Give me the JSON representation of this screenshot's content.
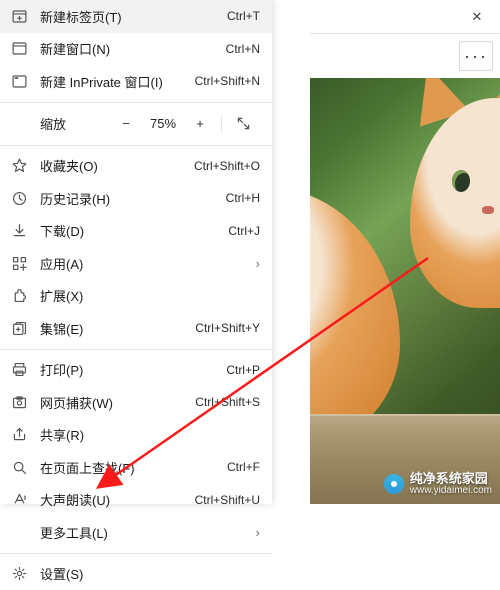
{
  "browser": {
    "close_label": "✕",
    "more_label": "···"
  },
  "watermark": {
    "name": "纯净系统家园",
    "url": "www.yidaimei.com"
  },
  "menu": {
    "newTab": {
      "label": "新建标签页(T)",
      "shortcut": "Ctrl+T"
    },
    "newWindow": {
      "label": "新建窗口(N)",
      "shortcut": "Ctrl+N"
    },
    "newInPrivate": {
      "label": "新建 InPrivate 窗口(I)",
      "shortcut": "Ctrl+Shift+N"
    },
    "zoom": {
      "label": "缩放",
      "out": "−",
      "value": "75%",
      "in": "+",
      "full": "⛶"
    },
    "favorites": {
      "label": "收藏夹(O)",
      "shortcut": "Ctrl+Shift+O"
    },
    "history": {
      "label": "历史记录(H)",
      "shortcut": "Ctrl+H"
    },
    "downloads": {
      "label": "下载(D)",
      "shortcut": "Ctrl+J"
    },
    "apps": {
      "label": "应用(A)"
    },
    "extensions": {
      "label": "扩展(X)"
    },
    "collections": {
      "label": "集锦(E)",
      "shortcut": "Ctrl+Shift+Y"
    },
    "print": {
      "label": "打印(P)",
      "shortcut": "Ctrl+P"
    },
    "capture": {
      "label": "网页捕获(W)",
      "shortcut": "Ctrl+Shift+S"
    },
    "share": {
      "label": "共享(R)"
    },
    "find": {
      "label": "在页面上查找(F)",
      "shortcut": "Ctrl+F"
    },
    "readAloud": {
      "label": "大声朗读(U)",
      "shortcut": "Ctrl+Shift+U"
    },
    "moreTools": {
      "label": "更多工具(L)"
    },
    "settings": {
      "label": "设置(S)"
    },
    "chevron": "›"
  }
}
